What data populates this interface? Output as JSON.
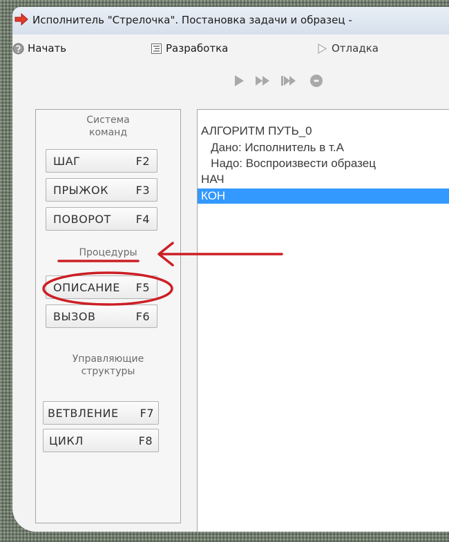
{
  "window": {
    "title": "Исполнитель \"Стрелочка\". Постановка задачи и образец - "
  },
  "menu": {
    "start_label": "Начать",
    "develop_label": "Разработка",
    "debug_label": "Отладка"
  },
  "toolbar": {
    "buttons": [
      {
        "icon": "play-icon"
      },
      {
        "icon": "fast-forward-icon"
      },
      {
        "icon": "step-forward-icon"
      },
      {
        "icon": "stop-icon"
      }
    ]
  },
  "command_panel": {
    "system_label_line1": "Система",
    "system_label_line2": "команд",
    "buttons": [
      {
        "label": "ШАГ",
        "key": "F2"
      },
      {
        "label": "ПРЫЖОК",
        "key": "F3"
      },
      {
        "label": "ПОВОРОТ",
        "key": "F4"
      },
      {
        "label": "ОПИСАНИЕ",
        "key": "F5"
      },
      {
        "label": "ВЫЗОВ",
        "key": "F6"
      },
      {
        "label": "ВЕТВЛЕНИЕ",
        "key": "F7"
      },
      {
        "label": "ЦИКЛ",
        "key": "F8"
      }
    ],
    "procedures_label": "Процедуры",
    "control_label_line1": "Управляющие",
    "control_label_line2": "структуры"
  },
  "editor": {
    "lines": [
      "АЛГОРИТМ ПУТЬ_0",
      "   Дано: Исполнитель в т.А",
      "   Надо: Воспроизвести образец",
      "НАЧ",
      "КОН"
    ],
    "selected_line": 4
  },
  "colors": {
    "annotation": "#cc1f24",
    "selection": "#3399ff",
    "titlebar": "#dbe4ef"
  }
}
